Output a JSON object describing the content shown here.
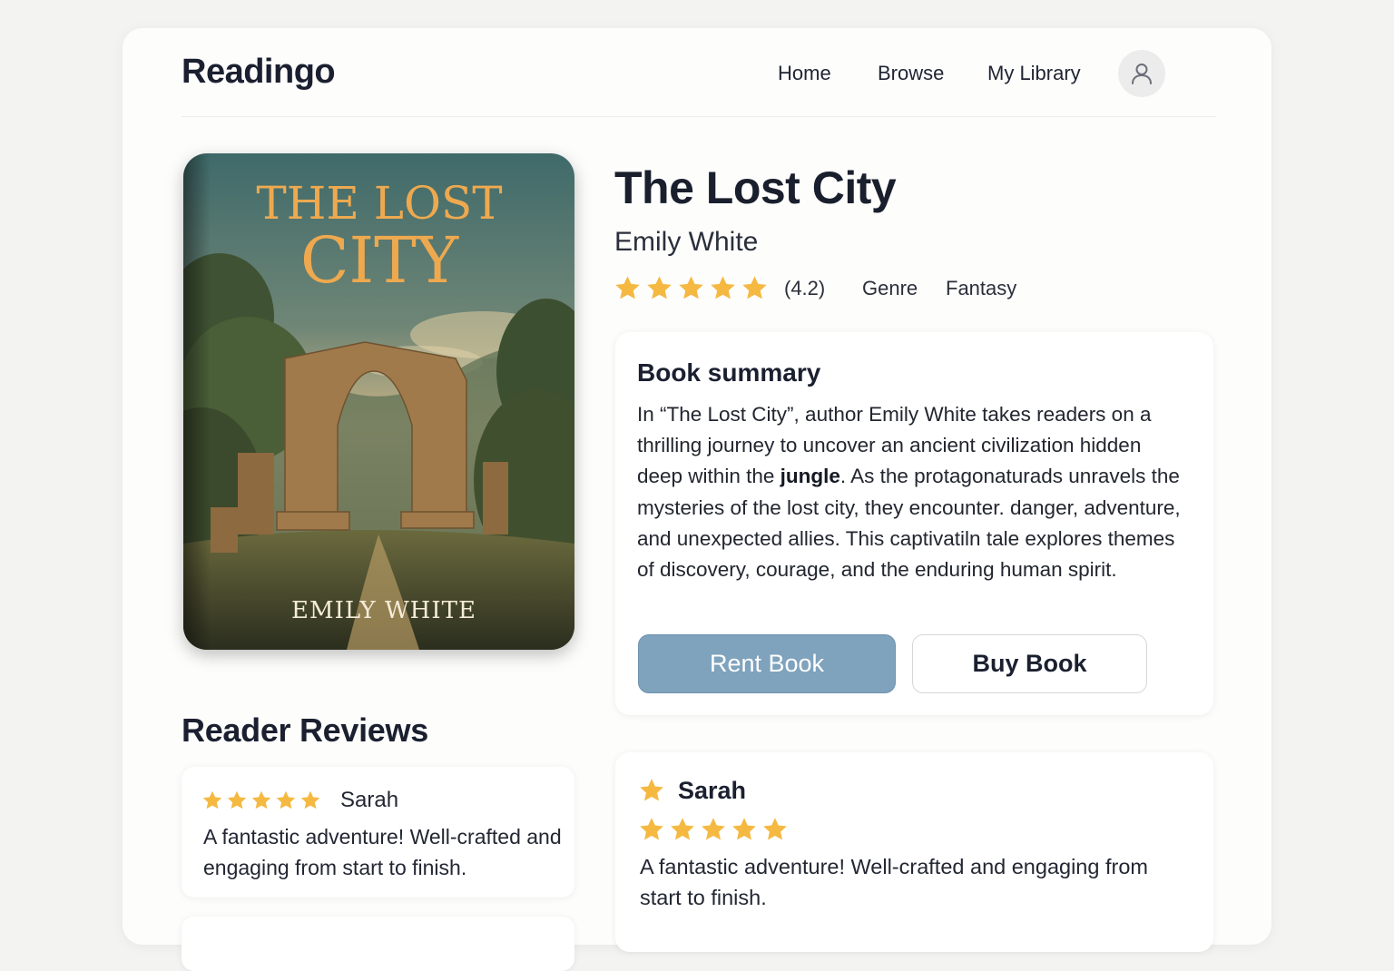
{
  "app": {
    "brand": "Readingo"
  },
  "nav": {
    "items": [
      {
        "label": "Home"
      },
      {
        "label": "Browse"
      },
      {
        "label": "My Library"
      }
    ],
    "avatar_icon": "user-icon"
  },
  "book": {
    "cover": {
      "title_line1": "THE LOST",
      "title_line2": "CITY",
      "author": "EMILY WHITE"
    },
    "title": "The Lost City",
    "author": "Emily White",
    "rating_stars": 5,
    "rating_text": "(4.2)",
    "genre_label": "Genre",
    "genre_value": "Fantasy"
  },
  "summary": {
    "heading": "Book summary",
    "text_before_bold": "In “The Lost City”, author Emily White takes readers on a thrilling journey to uncover an ancient civilization hidden deep within the ",
    "text_bold": "jungle",
    "text_after_bold": ". As the protagonaturads unravels the mysteries of the lost city, they encounter. danger, adventure, and unexpected allies. This captivatiln tale explores themes of discovery, courage, and the enduring human spirit.",
    "rent_label": "Rent Book",
    "buy_label": "Buy Book"
  },
  "reviews": {
    "heading": "Reader Reviews",
    "items": [
      {
        "name": "Sarah",
        "stars": 5,
        "text": "A fantastic adventure!  Well-crafted and engaging from start to finish."
      },
      {
        "name": "Sarah",
        "stars": 5,
        "text": "A fantastic adventure!   Well-crafted and engaging from start to finish."
      }
    ]
  },
  "colors": {
    "star": "#f5b942",
    "rent_button": "#7fa2bd",
    "brand_text": "#1b2030",
    "cover_title": "#eea94f"
  }
}
